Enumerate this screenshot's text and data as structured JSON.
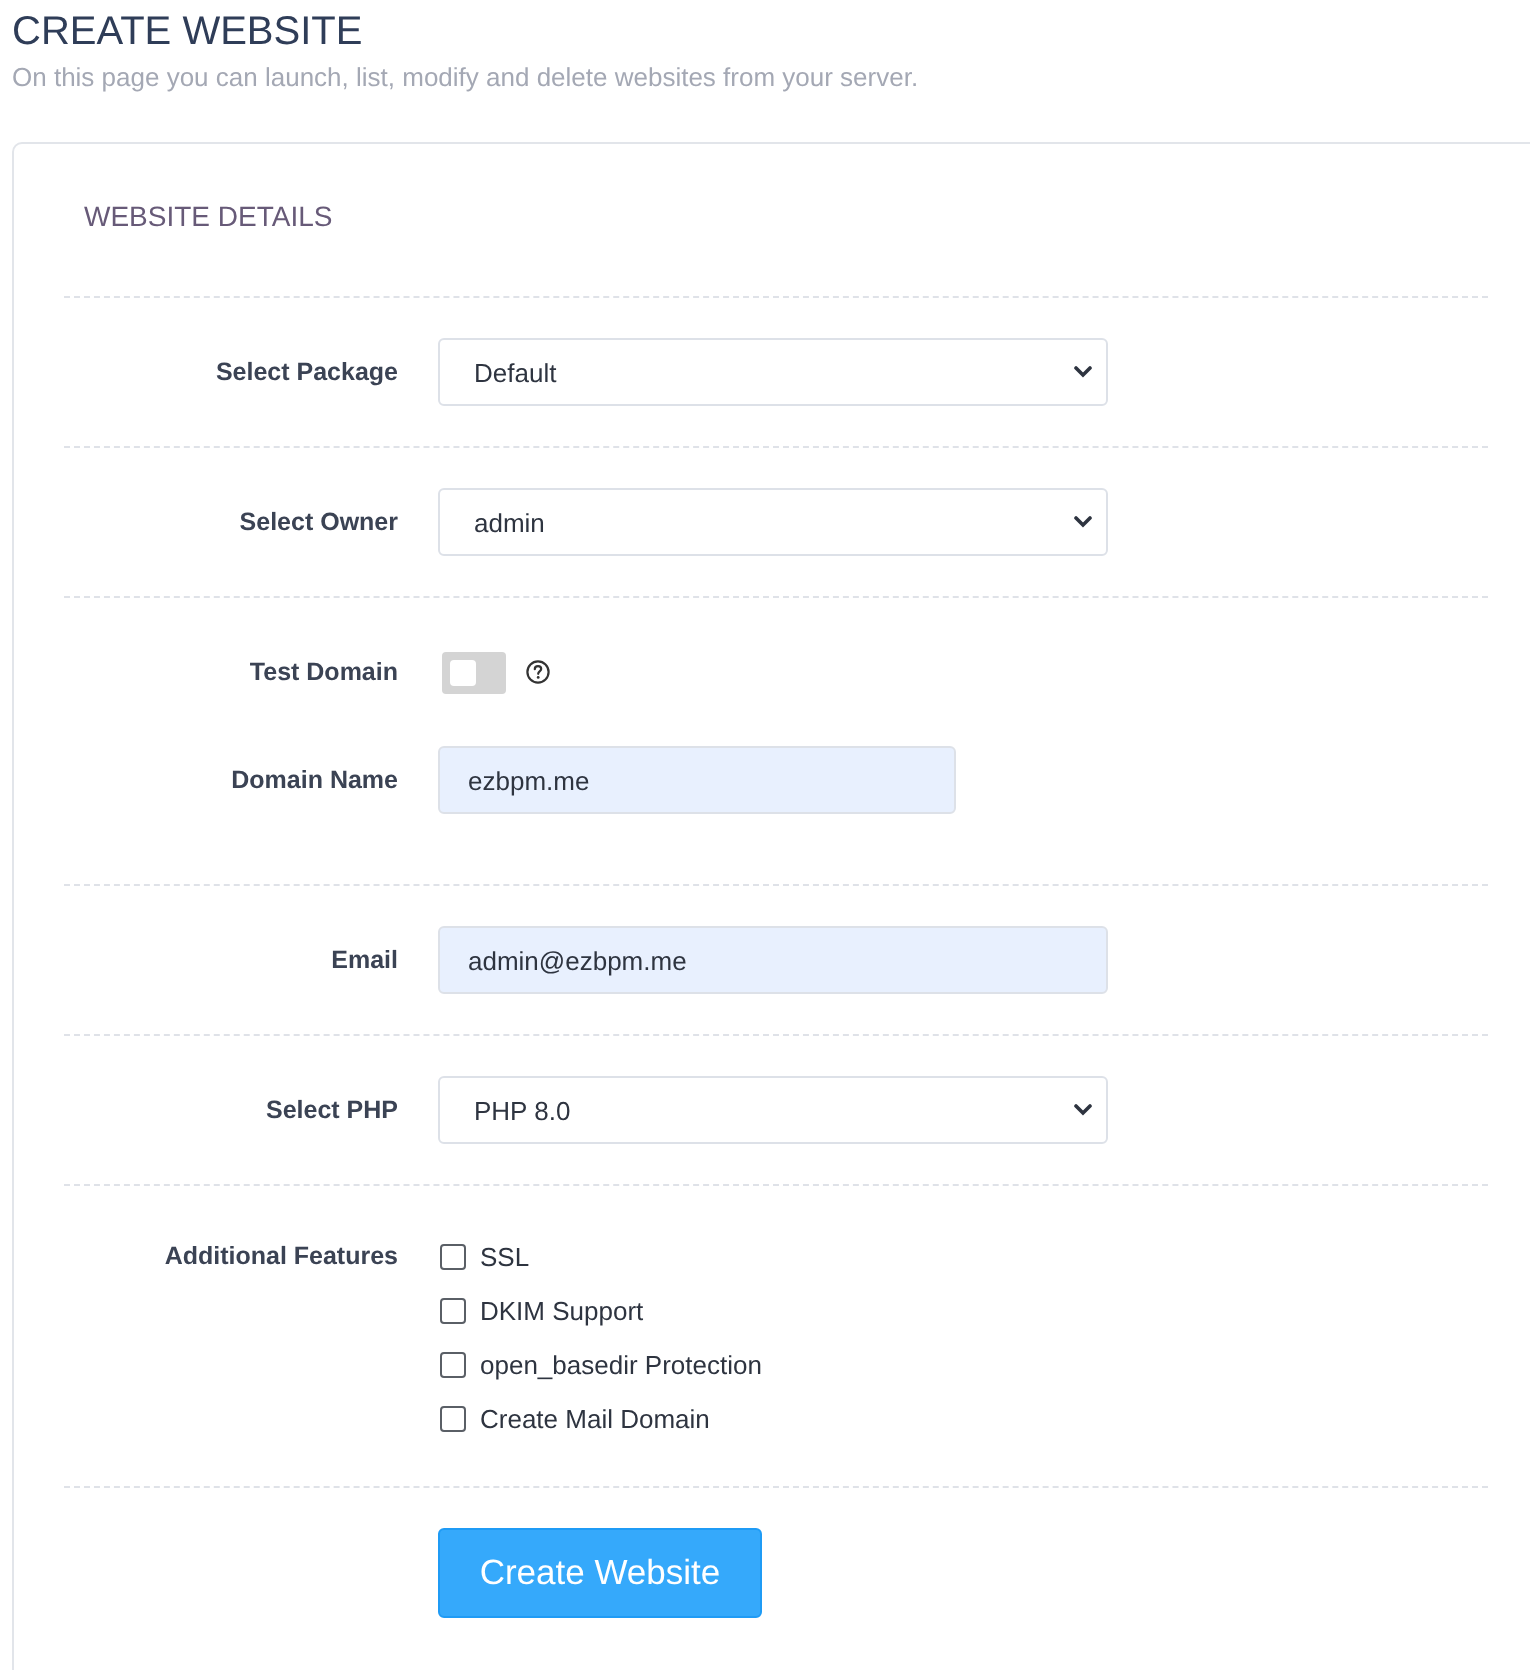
{
  "page": {
    "title": "CREATE WEBSITE",
    "subtitle": "On this page you can launch, list, modify and delete websites from your server."
  },
  "card": {
    "heading": "WEBSITE DETAILS"
  },
  "sections": [
    {
      "fields": [
        {
          "kind": "select",
          "label": "Select Package",
          "value": "Default"
        }
      ]
    },
    {
      "fields": [
        {
          "kind": "select",
          "label": "Select Owner",
          "value": "admin"
        }
      ]
    },
    {
      "fields": [
        {
          "kind": "toggle",
          "label": "Test Domain",
          "on": false
        },
        {
          "kind": "short-input",
          "label": "Domain Name",
          "value": "ezbpm.me"
        }
      ]
    },
    {
      "fields": [
        {
          "kind": "input",
          "label": "Email",
          "value": "admin@ezbpm.me"
        }
      ]
    },
    {
      "fields": [
        {
          "kind": "select",
          "label": "Select PHP",
          "value": "PHP 8.0"
        }
      ]
    },
    {
      "fields": [
        {
          "kind": "checkboxes",
          "label": "Additional Features",
          "options": [
            {
              "label": "SSL",
              "checked": false
            },
            {
              "label": "DKIM Support",
              "checked": false
            },
            {
              "label": "open_basedir Protection",
              "checked": false
            },
            {
              "label": "Create Mail Domain",
              "checked": false
            }
          ]
        }
      ]
    }
  ],
  "submit": {
    "label": "Create Website"
  }
}
